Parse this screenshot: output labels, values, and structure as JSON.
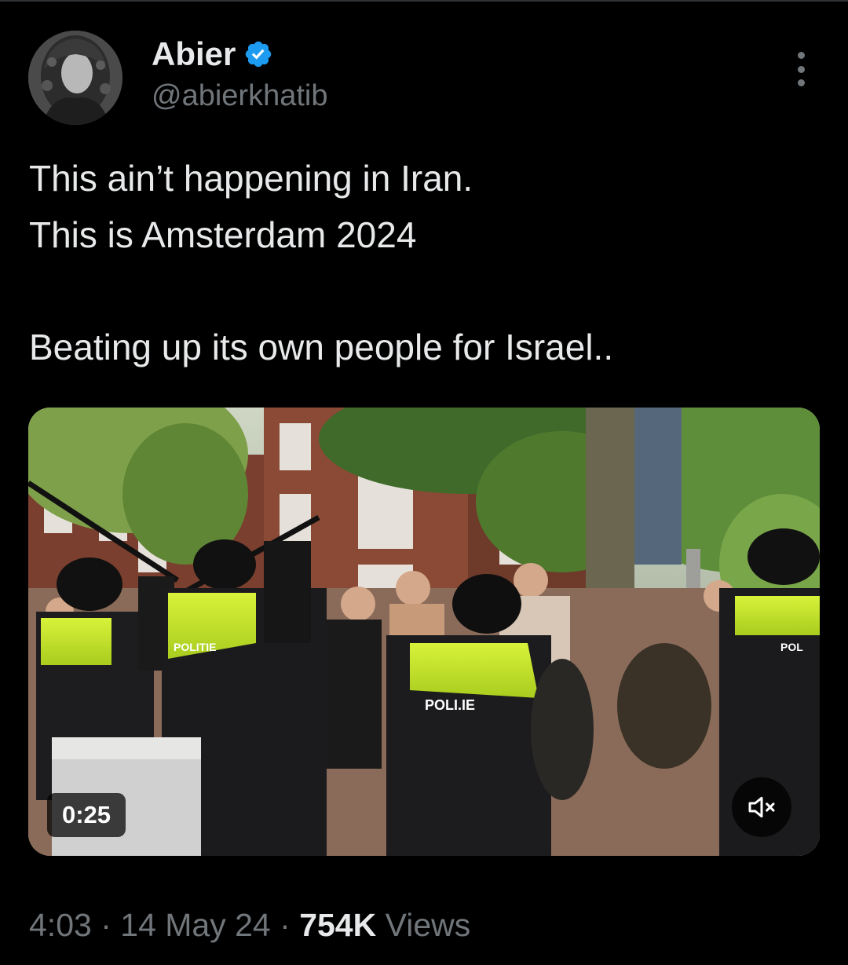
{
  "author": {
    "display_name": "Abier",
    "handle": "@abierkhatib",
    "verified_icon": "verified-badge-icon",
    "verified_color": "#1d9bf0"
  },
  "tweet": {
    "lines": [
      "This ain’t happening in Iran.",
      "This is Amsterdam 2024",
      "Beating up its own people for Israel.."
    ]
  },
  "media": {
    "type": "video",
    "duration": "0:25",
    "mute_icon": "speaker-muted-icon",
    "vest_text_1": "POLITIE",
    "vest_text_2": "POLI.IE",
    "vest_text_3": "POL"
  },
  "meta": {
    "time": "4:03",
    "separator": "·",
    "date": "14 May 24",
    "views_count": "754K",
    "views_label": "Views"
  },
  "colors": {
    "background": "#000000",
    "primary_text": "#e7e9ea",
    "secondary_text": "#71767b",
    "accent": "#1d9bf0"
  }
}
